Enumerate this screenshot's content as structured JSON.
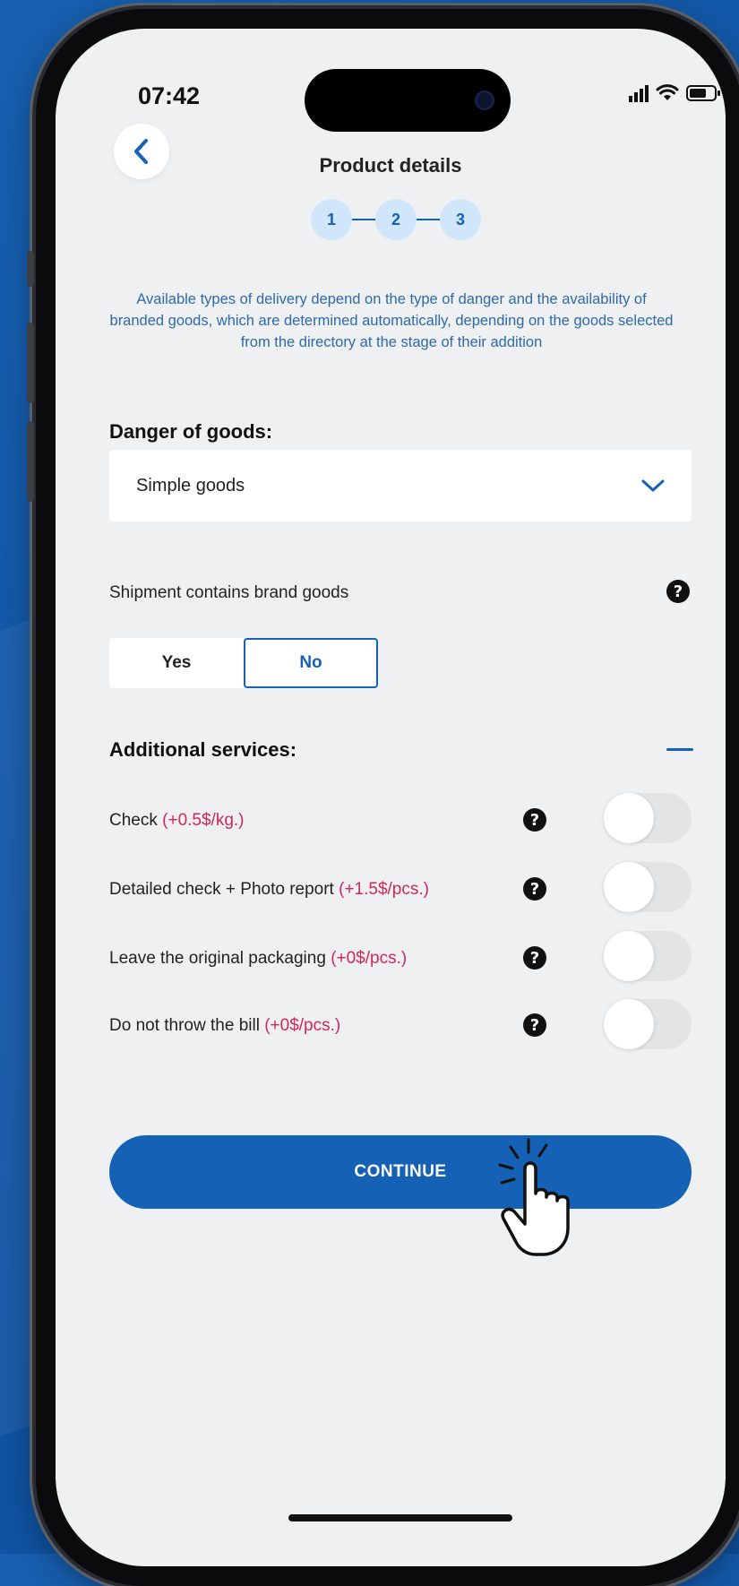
{
  "status_bar": {
    "time": "07:42"
  },
  "header": {
    "title": "Product details"
  },
  "stepper": {
    "steps": [
      "1",
      "2",
      "3"
    ]
  },
  "info_text": "Available types of delivery depend on the type of danger and the availability of branded goods, which are determined automatically, depending on the goods selected from the directory at the stage of their addition",
  "danger": {
    "label": "Danger of goods:",
    "selected": "Simple goods"
  },
  "brand": {
    "label": "Shipment contains brand goods",
    "options": {
      "yes": "Yes",
      "no": "No"
    },
    "selected": "No"
  },
  "services": {
    "label": "Additional services:",
    "items": [
      {
        "label": "Check ",
        "price": "(+0.5$/kg.)",
        "enabled": false
      },
      {
        "label": "Detailed check + Photo report ",
        "price": "(+1.5$/pcs.)",
        "enabled": false
      },
      {
        "label": "Leave the original packaging ",
        "price": "(+0$/pcs.)",
        "enabled": false
      },
      {
        "label": "Do not throw the bill ",
        "price": "(+0$/pcs.)",
        "enabled": false
      }
    ]
  },
  "continue_label": "CONTINUE",
  "colors": {
    "accent": "#1461b5",
    "price": "#d0285a",
    "screen_bg": "#eef0f2"
  },
  "icons": {
    "back": "chevron-left-icon",
    "dropdown": "chevron-down-icon",
    "help": "question-circle-icon",
    "collapse": "minus-icon",
    "cursor": "hand-pointer-icon"
  }
}
